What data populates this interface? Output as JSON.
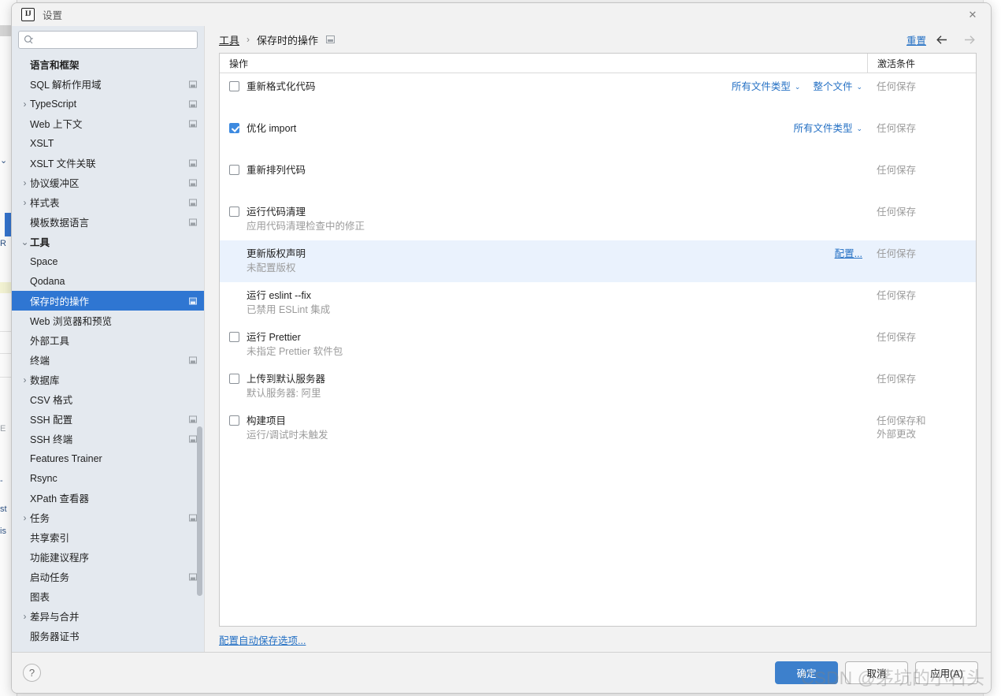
{
  "window": {
    "title": "设置",
    "logo_text": "IJ",
    "close_label": "✕"
  },
  "sidebar": {
    "search_placeholder": "",
    "search_value": "",
    "search_icon": "search-icon",
    "items": [
      {
        "label": "语言和框架",
        "indent": 0,
        "group": true,
        "arrow": "",
        "badge": false,
        "selected": false
      },
      {
        "label": "SQL 解析作用域",
        "indent": 1,
        "group": false,
        "arrow": "",
        "badge": true,
        "selected": false
      },
      {
        "label": "TypeScript",
        "indent": 1,
        "group": false,
        "arrow": "›",
        "badge": true,
        "selected": false
      },
      {
        "label": "Web 上下文",
        "indent": 1,
        "group": false,
        "arrow": "",
        "badge": true,
        "selected": false
      },
      {
        "label": "XSLT",
        "indent": 1,
        "group": false,
        "arrow": "",
        "badge": false,
        "selected": false
      },
      {
        "label": "XSLT 文件关联",
        "indent": 1,
        "group": false,
        "arrow": "",
        "badge": true,
        "selected": false
      },
      {
        "label": "协议缓冲区",
        "indent": 1,
        "group": false,
        "arrow": "›",
        "badge": true,
        "selected": false
      },
      {
        "label": "样式表",
        "indent": 1,
        "group": false,
        "arrow": "›",
        "badge": true,
        "selected": false
      },
      {
        "label": "模板数据语言",
        "indent": 1,
        "group": false,
        "arrow": "",
        "badge": true,
        "selected": false
      },
      {
        "label": "工具",
        "indent": 0,
        "group": true,
        "arrow": "⌄",
        "badge": false,
        "selected": false
      },
      {
        "label": "Space",
        "indent": 1,
        "group": false,
        "arrow": "",
        "badge": false,
        "selected": false
      },
      {
        "label": "Qodana",
        "indent": 1,
        "group": false,
        "arrow": "",
        "badge": false,
        "selected": false
      },
      {
        "label": "保存时的操作",
        "indent": 1,
        "group": false,
        "arrow": "",
        "badge": true,
        "selected": true
      },
      {
        "label": "Web 浏览器和预览",
        "indent": 1,
        "group": false,
        "arrow": "",
        "badge": false,
        "selected": false
      },
      {
        "label": "外部工具",
        "indent": 1,
        "group": false,
        "arrow": "",
        "badge": false,
        "selected": false
      },
      {
        "label": "终端",
        "indent": 1,
        "group": false,
        "arrow": "",
        "badge": true,
        "selected": false
      },
      {
        "label": "数据库",
        "indent": 1,
        "group": false,
        "arrow": "›",
        "badge": false,
        "selected": false
      },
      {
        "label": "CSV 格式",
        "indent": 1,
        "group": false,
        "arrow": "",
        "badge": false,
        "selected": false
      },
      {
        "label": "SSH 配置",
        "indent": 1,
        "group": false,
        "arrow": "",
        "badge": true,
        "selected": false
      },
      {
        "label": "SSH 终端",
        "indent": 1,
        "group": false,
        "arrow": "",
        "badge": true,
        "selected": false
      },
      {
        "label": "Features Trainer",
        "indent": 1,
        "group": false,
        "arrow": "",
        "badge": false,
        "selected": false
      },
      {
        "label": "Rsync",
        "indent": 1,
        "group": false,
        "arrow": "",
        "badge": false,
        "selected": false
      },
      {
        "label": "XPath 查看器",
        "indent": 1,
        "group": false,
        "arrow": "",
        "badge": false,
        "selected": false
      },
      {
        "label": "任务",
        "indent": 1,
        "group": false,
        "arrow": "›",
        "badge": true,
        "selected": false
      },
      {
        "label": "共享索引",
        "indent": 1,
        "group": false,
        "arrow": "",
        "badge": false,
        "selected": false
      },
      {
        "label": "功能建议程序",
        "indent": 1,
        "group": false,
        "arrow": "",
        "badge": false,
        "selected": false
      },
      {
        "label": "启动任务",
        "indent": 1,
        "group": false,
        "arrow": "",
        "badge": true,
        "selected": false
      },
      {
        "label": "图表",
        "indent": 1,
        "group": false,
        "arrow": "",
        "badge": false,
        "selected": false
      },
      {
        "label": "差异与合并",
        "indent": 1,
        "group": false,
        "arrow": "›",
        "badge": false,
        "selected": false
      },
      {
        "label": "服务器证书",
        "indent": 1,
        "group": false,
        "arrow": "",
        "badge": false,
        "selected": false
      }
    ]
  },
  "breadcrumb": {
    "parent": "工具",
    "separator": "›",
    "current": "保存时的操作",
    "reset_label": "重置",
    "back_icon": "arrow-left-icon",
    "forward_icon": "arrow-right-icon"
  },
  "table": {
    "headers": {
      "action": "操作",
      "condition": "激活条件"
    },
    "rows": [
      {
        "checkbox": "unchecked",
        "title": "重新格式化代码",
        "subtitle": "",
        "dropdowns": [
          "所有文件类型",
          "整个文件"
        ],
        "config_link": "",
        "condition": "任何保存",
        "highlight": false
      },
      {
        "checkbox": "checked",
        "title": "优化 import",
        "subtitle": "",
        "dropdowns": [
          "所有文件类型"
        ],
        "config_link": "",
        "condition": "任何保存",
        "highlight": false
      },
      {
        "checkbox": "unchecked",
        "title": "重新排列代码",
        "subtitle": "",
        "dropdowns": [],
        "config_link": "",
        "condition": "任何保存",
        "highlight": false
      },
      {
        "checkbox": "unchecked",
        "title": "运行代码清理",
        "subtitle": "应用代码清理检查中的修正",
        "dropdowns": [],
        "config_link": "",
        "condition": "任何保存",
        "highlight": false
      },
      {
        "checkbox": "none",
        "title": "更新版权声明",
        "subtitle": "未配置版权",
        "dropdowns": [],
        "config_link": "配置...",
        "condition": "任何保存",
        "highlight": true
      },
      {
        "checkbox": "none",
        "title": "运行 eslint --fix",
        "subtitle": "已禁用 ESLint 集成",
        "dropdowns": [],
        "config_link": "",
        "condition": "任何保存",
        "highlight": false
      },
      {
        "checkbox": "unchecked",
        "title": "运行 Prettier",
        "subtitle": "未指定 Prettier 软件包",
        "dropdowns": [],
        "config_link": "",
        "condition": "任何保存",
        "highlight": false
      },
      {
        "checkbox": "unchecked",
        "title": "上传到默认服务器",
        "subtitle": "默认服务器: 阿里",
        "dropdowns": [],
        "config_link": "",
        "condition": "任何保存",
        "highlight": false
      },
      {
        "checkbox": "unchecked",
        "title": "构建项目",
        "subtitle": "运行/调试时未触发",
        "dropdowns": [],
        "config_link": "",
        "condition": "任何保存和\n外部更改",
        "highlight": false
      }
    ]
  },
  "footer": {
    "autosave_link": "配置自动保存选项...",
    "help_label": "?",
    "ok_label": "确定",
    "cancel_label": "取消",
    "apply_label": "应用(A)"
  },
  "watermark": "CSDN @茅坑的小石头",
  "colors": {
    "accent": "#2f76d2",
    "link": "#2470c4",
    "primary_button": "#3d80cc",
    "checkbox_checked": "#3d8ae0",
    "row_highlight": "#eaf2fd",
    "sidebar_bg": "#e4e9ef"
  }
}
